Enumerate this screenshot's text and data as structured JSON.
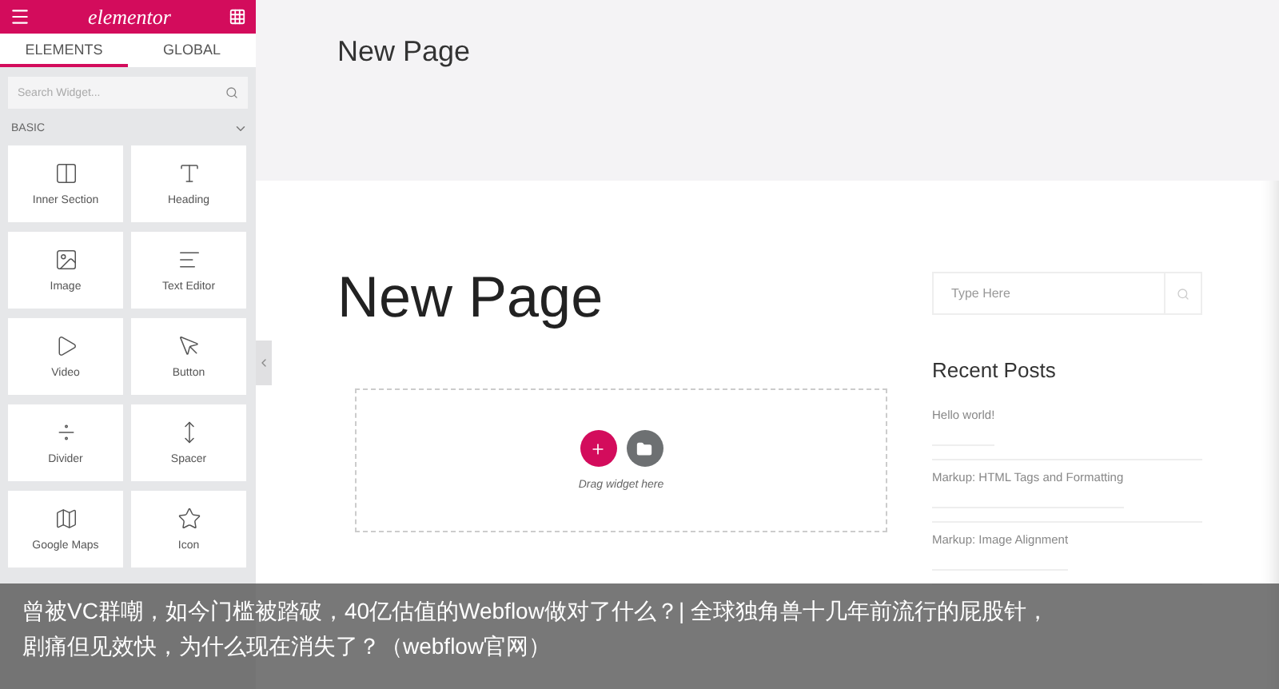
{
  "panel": {
    "logo": "elementor",
    "tabs": [
      {
        "label": "ELEMENTS",
        "selected": true
      },
      {
        "label": "GLOBAL",
        "selected": false
      }
    ],
    "search": {
      "placeholder": "Search Widget..."
    },
    "sections": [
      {
        "title": "BASIC",
        "expanded": true,
        "widgets": [
          {
            "label": "Inner Section",
            "kind": "columns"
          },
          {
            "label": "Heading",
            "kind": "heading"
          },
          {
            "label": "Image",
            "kind": "image"
          },
          {
            "label": "Text Editor",
            "kind": "text"
          },
          {
            "label": "Video",
            "kind": "video"
          },
          {
            "label": "Button",
            "kind": "button"
          },
          {
            "label": "Divider",
            "kind": "divider"
          },
          {
            "label": "Spacer",
            "kind": "spacer"
          },
          {
            "label": "Google Maps",
            "kind": "map"
          },
          {
            "label": "Icon",
            "kind": "icon"
          }
        ]
      }
    ]
  },
  "page": {
    "header_title": "New Page",
    "title": "New Page",
    "dropzone": {
      "hint": "Drag widget here"
    },
    "sidebar": {
      "search": {
        "placeholder": "Type Here"
      },
      "recent_posts": {
        "title": "Recent Posts",
        "items": [
          "Hello world!",
          "Markup: HTML Tags and Formatting",
          "Markup: Image Alignment"
        ]
      }
    }
  },
  "caption": {
    "lines": [
      "曾被VC群嘲，如今门槛被踏破，40亿估值的Webflow做对了什么？| 全球独角兽十几年前流行的屁股针，",
      "剧痛但见效快，为什么现在消失了？（webflow官网）"
    ]
  }
}
